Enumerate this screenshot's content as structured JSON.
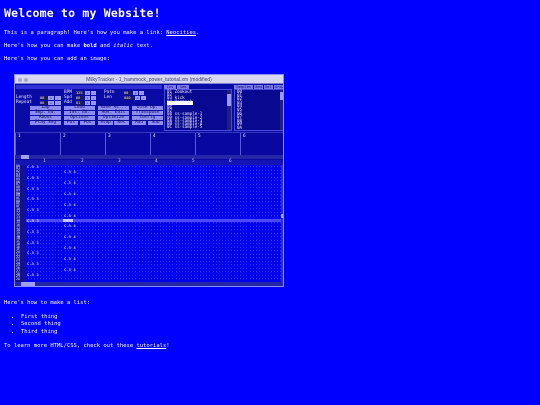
{
  "heading": "Welcome to my Website!",
  "para1": {
    "text": "This is a paragraph! Here's how you make a link: ",
    "link": "Neocities",
    "end": "."
  },
  "para2": {
    "pre": "Here's how you can make ",
    "bold": "bold",
    "mid": " and ",
    "italic": "italic",
    "post": " text."
  },
  "para3": "Here's how you can add an image:",
  "screenshot": {
    "title": "MilkyTracker - 1_hammock_power_tutorial.xm (modified)",
    "fields": [
      {
        "label": "Length",
        "value": "08"
      },
      {
        "label": "Repeat",
        "value": "00"
      },
      {
        "label": "BPM",
        "value": "125"
      },
      {
        "label": "Spd",
        "value": "06"
      },
      {
        "label": "Add",
        "value": "01"
      },
      {
        "label": "Patn",
        "value": "00"
      },
      {
        "label": "Len",
        "value": "040"
      }
    ],
    "buttons": [
      [
        "Zap",
        "Load",
        "Save As...",
        "Disk Op."
      ],
      [
        "Smp. Ed.",
        "Ins. Ed.",
        "Adv. Edit",
        "Transpose"
      ],
      [
        "About",
        "Options",
        "Optimize",
        "Config"
      ],
      [
        "Play Sng",
        "Pat",
        "Pos",
        "Stop",
        "Rec",
        "Add",
        "Sub"
      ]
    ],
    "instrument_tabs": [
      "Ins",
      "Sam"
    ],
    "instruments": [
      "01 Zookout",
      "02",
      "03 kick",
      "04 Hammock",
      "05",
      "06",
      "07",
      "08 ss-sample-1",
      "09 ss-sample-2",
      "0A ss-sample-3",
      "0B ss-sample-4",
      "0C ss-sample-5"
    ],
    "sample_tabs": [
      "Samples",
      "Add",
      "Del",
      "Grow"
    ],
    "samples": [
      "00",
      "01",
      "02",
      "03",
      "04",
      "05",
      "06",
      "07",
      "08",
      "09",
      "0A"
    ],
    "order_channels": [
      "1",
      "2",
      "3",
      "4",
      "5",
      "6"
    ],
    "pattern_channels": [
      "1",
      "2",
      "3",
      "4",
      "5",
      "6"
    ],
    "row_labels": [
      "00",
      "01",
      "02",
      "03",
      "04",
      "05",
      "06",
      "07",
      "08",
      "09",
      "0A",
      "0B",
      "0C",
      "0D",
      "0E",
      "0F",
      "10",
      "11",
      "12",
      "13",
      "14",
      "15",
      "16",
      "17",
      "18",
      "19",
      "1A",
      "1B",
      "1C",
      "1D",
      "1E",
      "1F",
      "20",
      "21",
      "22",
      "23",
      "24",
      "25",
      "26",
      "27",
      "28",
      "29",
      "2A"
    ],
    "note_cells": {
      "col1": [
        "C-5 3",
        "C-5 3",
        "C-5 3",
        "C-5 3",
        "C-5 3",
        "C-5 3",
        "C-5 3",
        "C-5 3",
        "C-5 3",
        "C-5 3",
        "C-5 3"
      ],
      "col2": [
        "C-5 4",
        "C-5 4",
        "C-5 4",
        "C-5 4",
        "C-5 4",
        "C-5 4",
        "C-5 4",
        "C-5 4",
        "C-5 4",
        "C-5 4"
      ]
    }
  },
  "list_intro": "Here's how to make a list:",
  "list": [
    "First thing",
    "Second thing",
    "Third thing"
  ],
  "outro": {
    "pre": "To learn more HTML/CSS, check out these ",
    "link": "tutorials",
    "post": "!"
  }
}
